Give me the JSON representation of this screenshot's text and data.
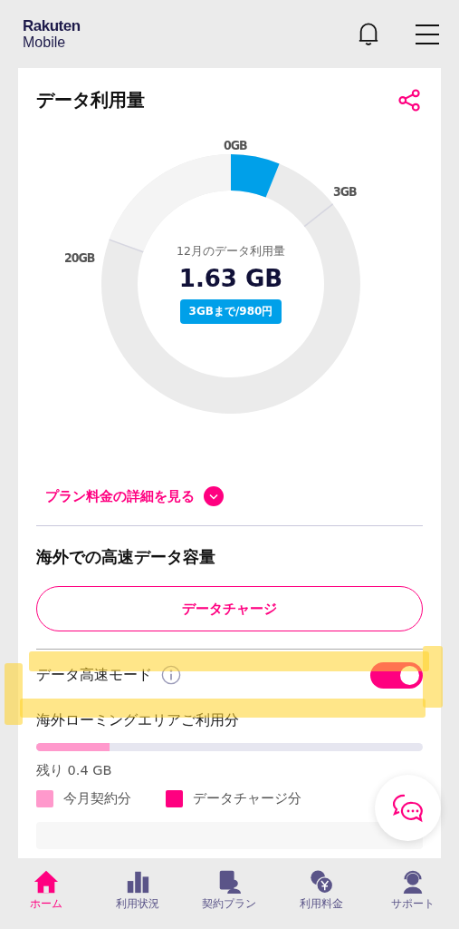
{
  "header": {
    "logo_top": "Rakuten",
    "logo_bottom": "Mobile"
  },
  "usage": {
    "title": "データ利用量",
    "gauge": {
      "labels": [
        "0GB",
        "3GB",
        "20GB"
      ]
    },
    "caption": "12月のデータ利用量",
    "amount": "1.63 GB",
    "price_badge": "3GBまで/980円"
  },
  "plan_link": "プラン料金の詳細を見る",
  "overseas": {
    "title": "海外での高速データ容量",
    "charge_button": "データチャージ",
    "fast_mode": {
      "label": "データ高速モード",
      "on": true
    },
    "roaming_label": "海外ローミングエリアご利用分",
    "bar": {
      "level": 0.19
    },
    "remaining": "残り 0.4 GB",
    "legend": [
      {
        "label": "今月契約分",
        "color": "#ff99cc"
      },
      {
        "label": "データチャージ分",
        "color": "#ff0080"
      }
    ]
  },
  "nav": [
    {
      "label": "ホーム",
      "kind": "home",
      "selected": true
    },
    {
      "label": "利用状況",
      "kind": "usage",
      "selected": false
    },
    {
      "label": "契約プラン",
      "kind": "plan",
      "selected": false
    },
    {
      "label": "利用料金",
      "kind": "fee",
      "selected": false
    },
    {
      "label": "サポート",
      "kind": "support",
      "selected": false
    }
  ]
}
